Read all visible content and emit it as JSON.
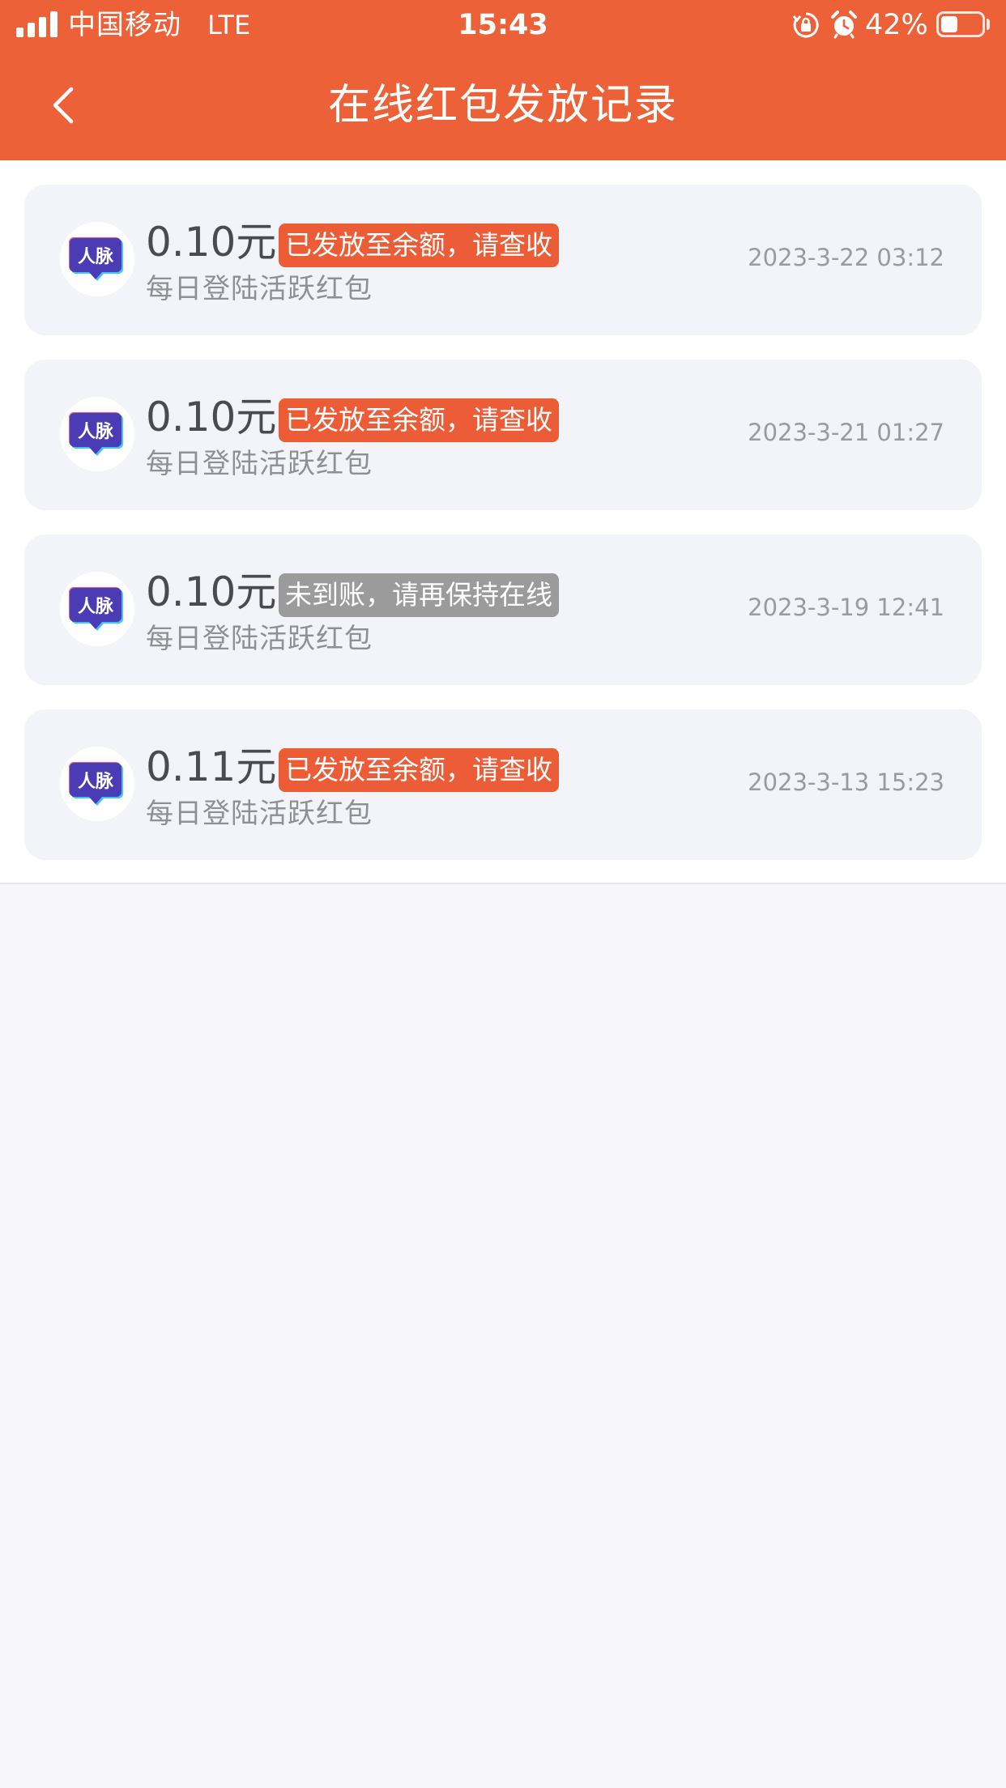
{
  "status_bar": {
    "carrier": "中国移动",
    "network": "LTE",
    "time": "15:43",
    "battery_percent": "42%",
    "battery_level": 0.42
  },
  "nav": {
    "title": "在线红包发放记录",
    "back_icon": "chevron-left-icon"
  },
  "colors": {
    "header": "#ec6137",
    "badge_sent": "#ec5c36",
    "badge_pending": "#9b9b9b",
    "card": "#f3f4f9",
    "page_bg": "#f7f7f9"
  },
  "records": [
    {
      "amount": "0.10元",
      "status": "已发放至余额，请查收",
      "status_type": "sent",
      "desc": "每日登陆活跃红包",
      "datetime": "2023-3-22 03:12",
      "avatar_text": "人脉"
    },
    {
      "amount": "0.10元",
      "status": "已发放至余额，请查收",
      "status_type": "sent",
      "desc": "每日登陆活跃红包",
      "datetime": "2023-3-21 01:27",
      "avatar_text": "人脉"
    },
    {
      "amount": "0.10元",
      "status": "未到账，请再保持在线",
      "status_type": "pending",
      "desc": "每日登陆活跃红包",
      "datetime": "2023-3-19 12:41",
      "avatar_text": "人脉"
    },
    {
      "amount": "0.11元",
      "status": "已发放至余额，请查收",
      "status_type": "sent",
      "desc": "每日登陆活跃红包",
      "datetime": "2023-3-13 15:23",
      "avatar_text": "人脉"
    }
  ]
}
